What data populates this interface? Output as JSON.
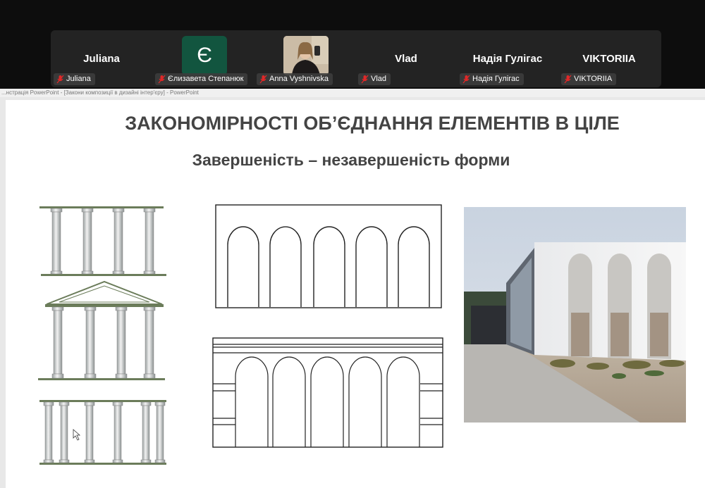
{
  "participants": [
    {
      "display_name": "Juliana",
      "label": "Juliana",
      "muted": true
    },
    {
      "display_name": "Є",
      "label": "Єлизавета Степанюк",
      "muted": true
    },
    {
      "display_name": "",
      "label": "Anna Vyshnivska",
      "muted": true
    },
    {
      "display_name": "Vlad",
      "label": "Vlad",
      "muted": true
    },
    {
      "display_name": "Надія Гулігас",
      "label": "Надія Гулігас",
      "muted": true
    },
    {
      "display_name": "VIKTORIIA",
      "label": "VIKTORIIA",
      "muted": true
    }
  ],
  "window": {
    "title": "...нстрація PowerPoint - [Закони композиції в дизайні інтер'єру] - PowerPoint"
  },
  "slide": {
    "title": "ЗАКОНОМІРНОСТІ ОБ’ЄДНАННЯ ЕЛЕМЕНТІВ В ЦІЛЕ",
    "subtitle": "Завершеність – незавершеність форми"
  },
  "icons": {
    "mic": "microphone-muted-icon"
  },
  "colors": {
    "muted_red": "#e02828",
    "avatar_green": "#12553f",
    "title_text": "#444444"
  }
}
